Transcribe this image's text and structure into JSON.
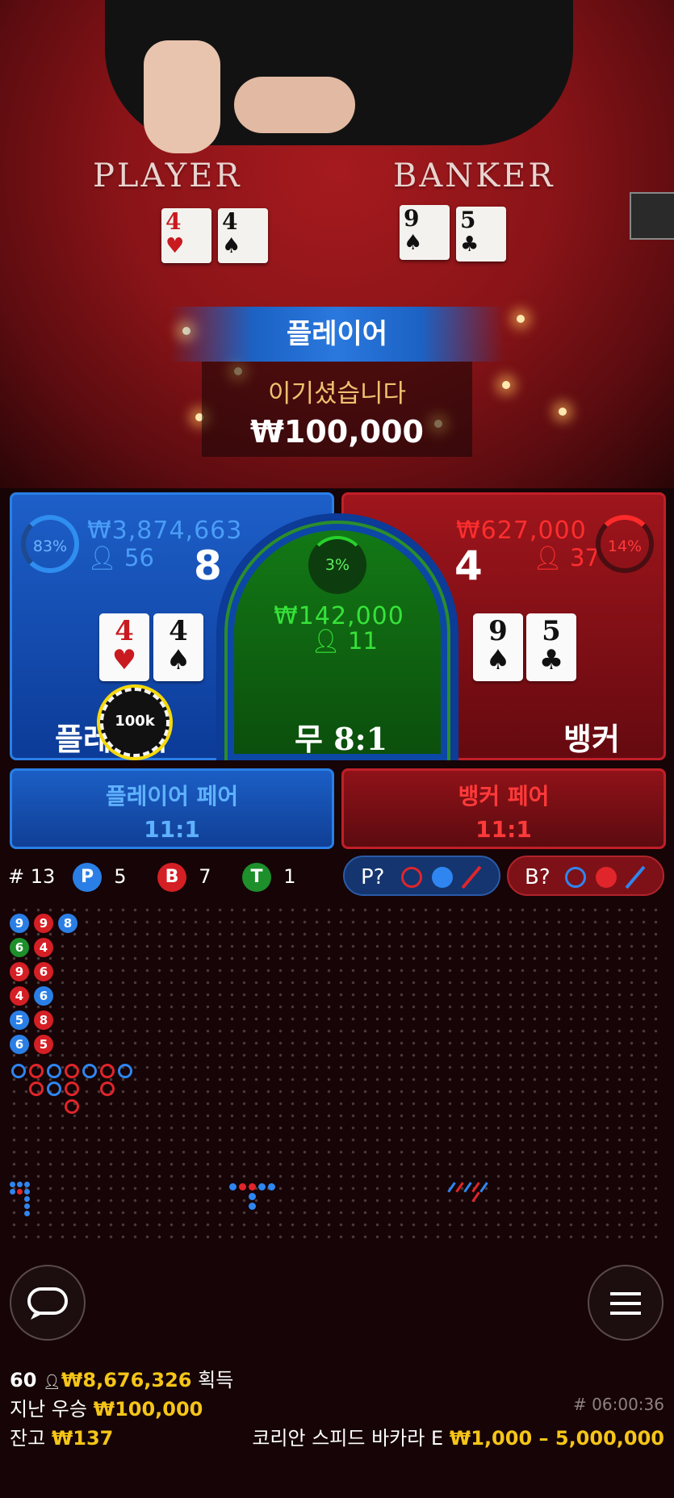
{
  "table": {
    "player_word": "PLAYER",
    "banker_word": "BANKER",
    "player_cards": [
      {
        "rank": "4",
        "suit": "♥",
        "color": "red"
      },
      {
        "rank": "4",
        "suit": "♠",
        "color": "black"
      }
    ],
    "banker_cards": [
      {
        "rank": "9",
        "suit": "♠",
        "color": "black"
      },
      {
        "rank": "5",
        "suit": "♣",
        "color": "black"
      }
    ]
  },
  "result": {
    "winner": "플레이어",
    "message": "이기셨습니다",
    "amount": "₩100,000"
  },
  "player_spot": {
    "percent": "83%",
    "percent_value": 0.83,
    "total": "₩3,874,663",
    "bettors": "56",
    "score": "8",
    "cards": [
      {
        "rank": "4",
        "suit": "♥"
      },
      {
        "rank": "4",
        "suit": "♠"
      }
    ],
    "label": "플레이어",
    "chip": "100k"
  },
  "tie_spot": {
    "percent": "3%",
    "percent_value": 0.03,
    "total": "₩142,000",
    "bettors": "11",
    "label": "무",
    "payout": "8:1"
  },
  "banker_spot": {
    "percent": "14%",
    "percent_value": 0.14,
    "total": "₩627,000",
    "bettors": "37",
    "score": "4",
    "cards": [
      {
        "rank": "9",
        "suit": "♠"
      },
      {
        "rank": "5",
        "suit": "♣"
      }
    ],
    "label": "뱅커"
  },
  "player_pair": {
    "label": "플레이어 페어",
    "payout": "11:1"
  },
  "banker_pair": {
    "label": "뱅커 페어",
    "payout": "11:1"
  },
  "stats": {
    "round_prefix": "#",
    "round": "13",
    "p_letter": "P",
    "p_count": "5",
    "b_letter": "B",
    "b_count": "7",
    "t_letter": "T",
    "t_count": "1"
  },
  "predict": {
    "player": "P?",
    "banker": "B?"
  },
  "bead_road": [
    [
      {
        "v": "9",
        "c": "blue"
      },
      {
        "v": "9",
        "c": "red"
      },
      {
        "v": "8",
        "c": "blue"
      }
    ],
    [
      {
        "v": "6",
        "c": "green"
      },
      {
        "v": "4",
        "c": "red"
      }
    ],
    [
      {
        "v": "9",
        "c": "red"
      },
      {
        "v": "6",
        "c": "red"
      }
    ],
    [
      {
        "v": "4",
        "c": "red"
      },
      {
        "v": "6",
        "c": "blue"
      }
    ],
    [
      {
        "v": "5",
        "c": "blue"
      },
      {
        "v": "8",
        "c": "red"
      }
    ],
    [
      {
        "v": "6",
        "c": "blue"
      },
      {
        "v": "5",
        "c": "red"
      }
    ]
  ],
  "footer": {
    "players_online": "60",
    "winnings": "₩8,676,326",
    "winnings_label": "획득",
    "last_win_label": "지난 우승",
    "last_win": "₩100,000",
    "timer": "# 06:00:36",
    "balance_label": "잔고",
    "balance": "₩137",
    "table_name": "코리안 스피드 바카라 E",
    "limits": "₩1,000 – 5,000,000"
  },
  "colors": {
    "player": "#1d5fc8",
    "banker": "#9f151c",
    "tie": "#137a16",
    "gold": "#f5c518"
  },
  "icons": [
    "person-icon",
    "chat-icon",
    "menu-icon",
    "chip-icon"
  ]
}
